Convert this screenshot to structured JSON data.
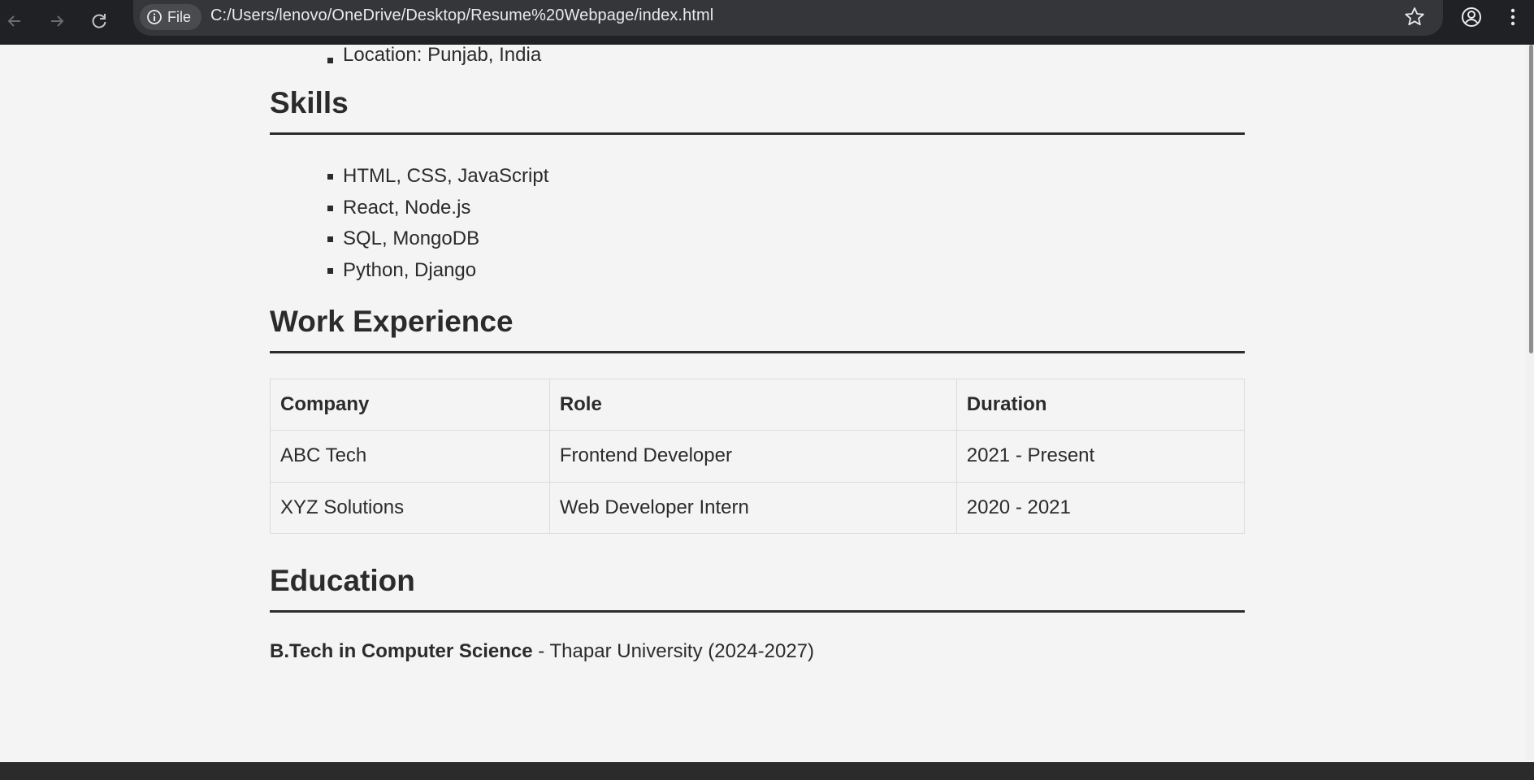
{
  "browser": {
    "chip_label": "File",
    "url": "C:/Users/lenovo/OneDrive/Desktop/Resume%20Webpage/index.html"
  },
  "contact": {
    "items": [
      "Location: Punjab, India"
    ]
  },
  "skills": {
    "heading": "Skills",
    "items": [
      "HTML, CSS, JavaScript",
      "React, Node.js",
      "SQL, MongoDB",
      "Python, Django"
    ]
  },
  "work": {
    "heading": "Work Experience",
    "columns": [
      "Company",
      "Role",
      "Duration"
    ],
    "rows": [
      [
        "ABC Tech",
        "Frontend Developer",
        "2021 - Present"
      ],
      [
        "XYZ Solutions",
        "Web Developer Intern",
        "2020 - 2021"
      ]
    ]
  },
  "education": {
    "heading": "Education",
    "degree": "B.Tech in Computer Science",
    "detail": " - Thapar University (2024-2027)"
  },
  "icons": {
    "back": "arrow-left-icon",
    "forward": "arrow-right-icon",
    "reload": "reload-icon",
    "info": "info-icon",
    "bookmark": "star-icon",
    "profile": "account-icon",
    "menu": "more-vert-icon"
  }
}
